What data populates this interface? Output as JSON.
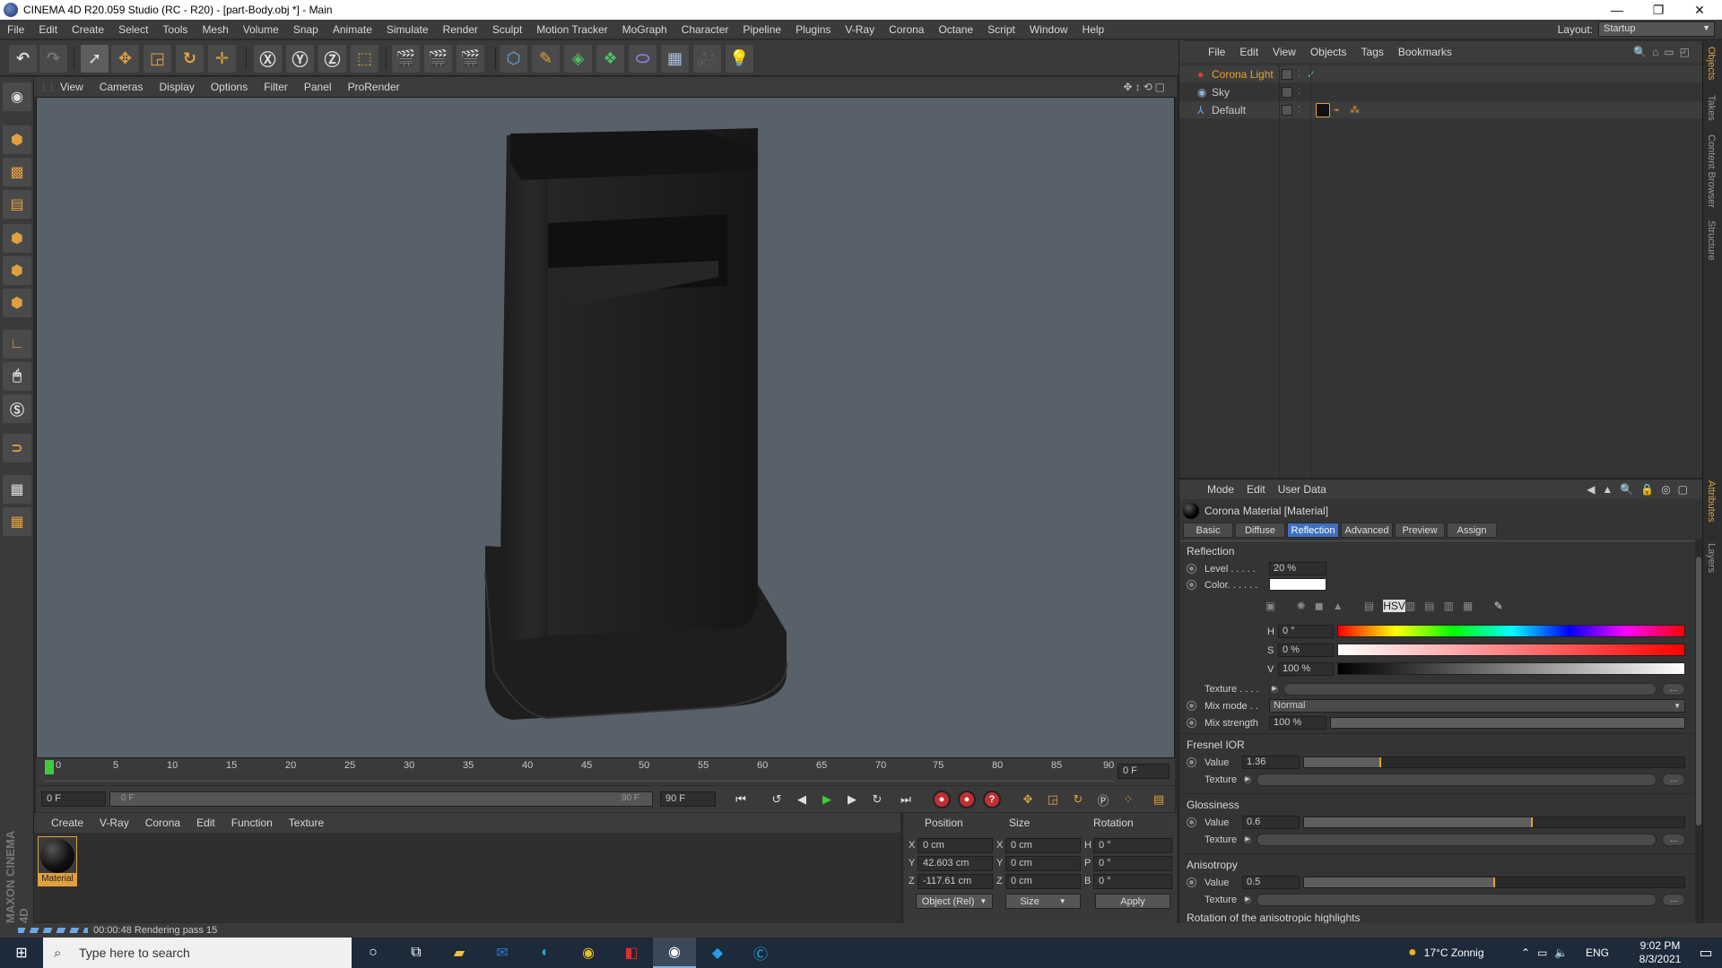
{
  "window": {
    "title": "CINEMA 4D R20.059 Studio (RC - R20) - [part-Body.obj *] - Main",
    "minimize": "—",
    "maximize": "❐",
    "close": "✕"
  },
  "menubar": {
    "items": [
      "File",
      "Edit",
      "Create",
      "Select",
      "Tools",
      "Mesh",
      "Volume",
      "Snap",
      "Animate",
      "Simulate",
      "Render",
      "Sculpt",
      "Motion Tracker",
      "MoGraph",
      "Character",
      "Pipeline",
      "Plugins",
      "V-Ray",
      "Corona",
      "Octane",
      "Script",
      "Window",
      "Help"
    ],
    "layout_label": "Layout:",
    "layout_value": "Startup"
  },
  "viewport": {
    "menu": [
      "View",
      "Cameras",
      "Display",
      "Options",
      "Filter",
      "Panel",
      "ProRender"
    ]
  },
  "timeline": {
    "ticks": [
      "0",
      "5",
      "10",
      "15",
      "20",
      "25",
      "30",
      "35",
      "40",
      "45",
      "50",
      "55",
      "60",
      "65",
      "70",
      "75",
      "80",
      "85",
      "90"
    ],
    "current_frame": "0 F"
  },
  "transport": {
    "start_field": "0 F",
    "range_start": "0 F",
    "range_end": "90 F",
    "end_field": "90 F"
  },
  "material_manager": {
    "menu": [
      "Create",
      "V-Ray",
      "Corona",
      "Edit",
      "Function",
      "Texture"
    ],
    "materials": [
      {
        "name": "Material"
      }
    ]
  },
  "coordinates": {
    "headers": {
      "position": "Position",
      "size": "Size",
      "rotation": "Rotation"
    },
    "rows": [
      {
        "axis": "X",
        "pos": "0 cm",
        "size_axis": "X",
        "size": "0 cm",
        "rot_axis": "H",
        "rot": "0 °"
      },
      {
        "axis": "Y",
        "pos": "42.603 cm",
        "size_axis": "Y",
        "size": "0 cm",
        "rot_axis": "P",
        "rot": "0 °"
      },
      {
        "axis": "Z",
        "pos": "-117.61 cm",
        "size_axis": "Z",
        "size": "0 cm",
        "rot_axis": "B",
        "rot": "0 °"
      }
    ],
    "mode": "Object (Rel)",
    "size_mode": "Size",
    "apply": "Apply"
  },
  "status": {
    "text": "00:00:48 Rendering pass 15"
  },
  "objects": {
    "menu": [
      "File",
      "Edit",
      "View",
      "Objects",
      "Tags",
      "Bookmarks"
    ],
    "items": [
      {
        "name": "Corona Light",
        "color": "#e8a030"
      },
      {
        "name": "Sky",
        "color": "#c8c8c8"
      },
      {
        "name": "Default",
        "color": "#c8c8c8"
      }
    ]
  },
  "right_tabs": [
    "Objects",
    "Takes",
    "Content Browser",
    "Structure",
    "Attributes",
    "Layers"
  ],
  "attributes": {
    "menu": [
      "Mode",
      "Edit",
      "User Data"
    ],
    "title": "Corona Material [Material]",
    "tabs": [
      "Basic",
      "Diffuse",
      "Reflection",
      "Advanced",
      "Preview",
      "Assign"
    ],
    "selected_tab": "Reflection",
    "section_reflection": "Reflection",
    "level_label": "Level . . . . .",
    "level_value": "20 %",
    "color_label": "Color. . . . . .",
    "h_label": "H",
    "h_value": "0 °",
    "s_label": "S",
    "s_value": "0 %",
    "v_label": "V",
    "v_value": "100 %",
    "texture_label": "Texture . . . .",
    "mixmode_label": "Mix mode . .",
    "mixmode_value": "Normal",
    "mixstrength_label": "Mix strength",
    "mixstrength_value": "100 %",
    "fresnel_section": "Fresnel IOR",
    "fresnel_value_label": "Value",
    "fresnel_value": "1.36",
    "fresnel_fill": 0.2,
    "fresnel_texture_label": "Texture",
    "gloss_section": "Glossiness",
    "gloss_value_label": "Value",
    "gloss_value": "0.6",
    "gloss_fill": 0.6,
    "gloss_texture_label": "Texture",
    "aniso_section": "Anisotropy",
    "aniso_value_label": "Value",
    "aniso_value": "0.5",
    "aniso_fill": 0.5,
    "aniso_texture_label": "Texture",
    "aniso_rotation_label": "Rotation of the anisotropic highlights",
    "dots": "..."
  },
  "taskbar": {
    "search_placeholder": "Type here to search",
    "weather": "17°C  Zonnig",
    "lang": "ENG",
    "time": "9:02 PM",
    "date": "8/3/2021"
  }
}
